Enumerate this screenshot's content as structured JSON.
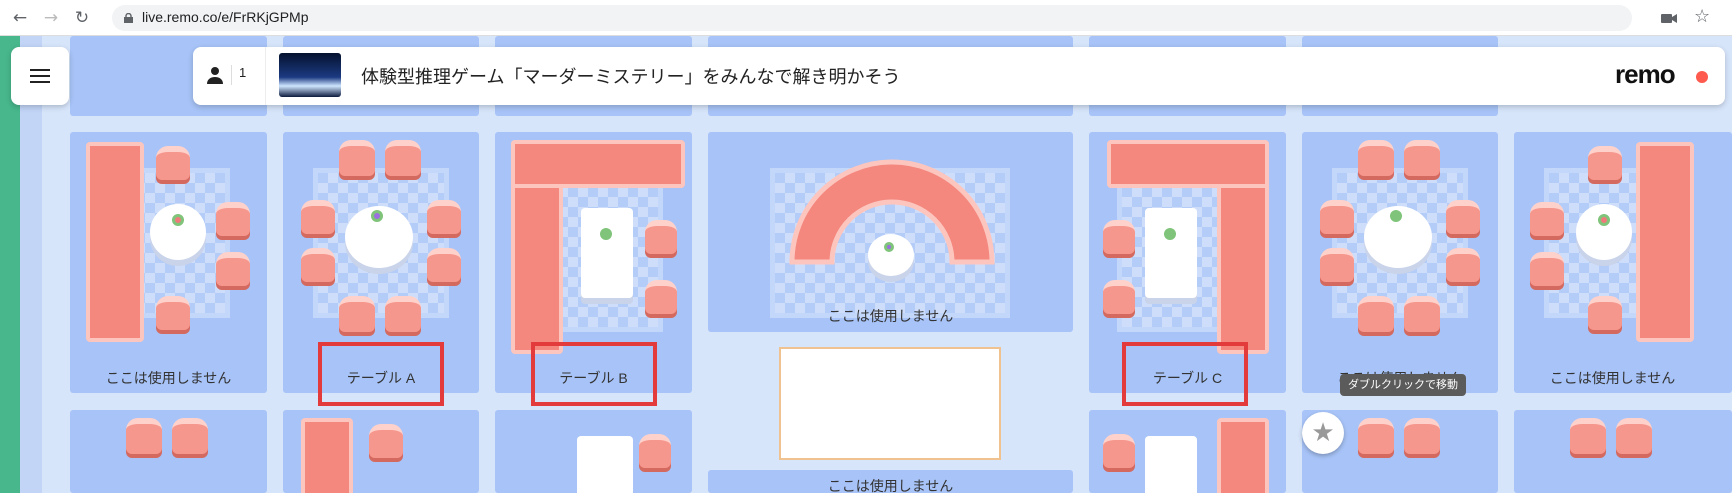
{
  "browser": {
    "back_icon": "arrow-left-icon",
    "forward_icon": "arrow-right-icon",
    "reload_icon": "reload-icon",
    "url": "live.remo.co/e/FrRKjGPMp"
  },
  "event": {
    "attendee_count": "1",
    "title": "体験型推理ゲーム「マーダーミステリー」をみんなで解き明かそう",
    "logo": "remo",
    "brand_color": "#ff5a4e"
  },
  "floor": {
    "rooms": [
      {
        "label": "ここは使用しません"
      },
      {
        "label": "テーブル A"
      },
      {
        "label": "テーブル B"
      },
      {
        "label": "ここは使用しません"
      },
      {
        "label": "テーブル C"
      },
      {
        "label": "ここは使用しません"
      },
      {
        "label": "ここは使用しません"
      },
      {
        "label": "ここは使用しません"
      }
    ],
    "highlight_color": "#e33b3b",
    "tooltip": "ダブルクリックで移動"
  }
}
